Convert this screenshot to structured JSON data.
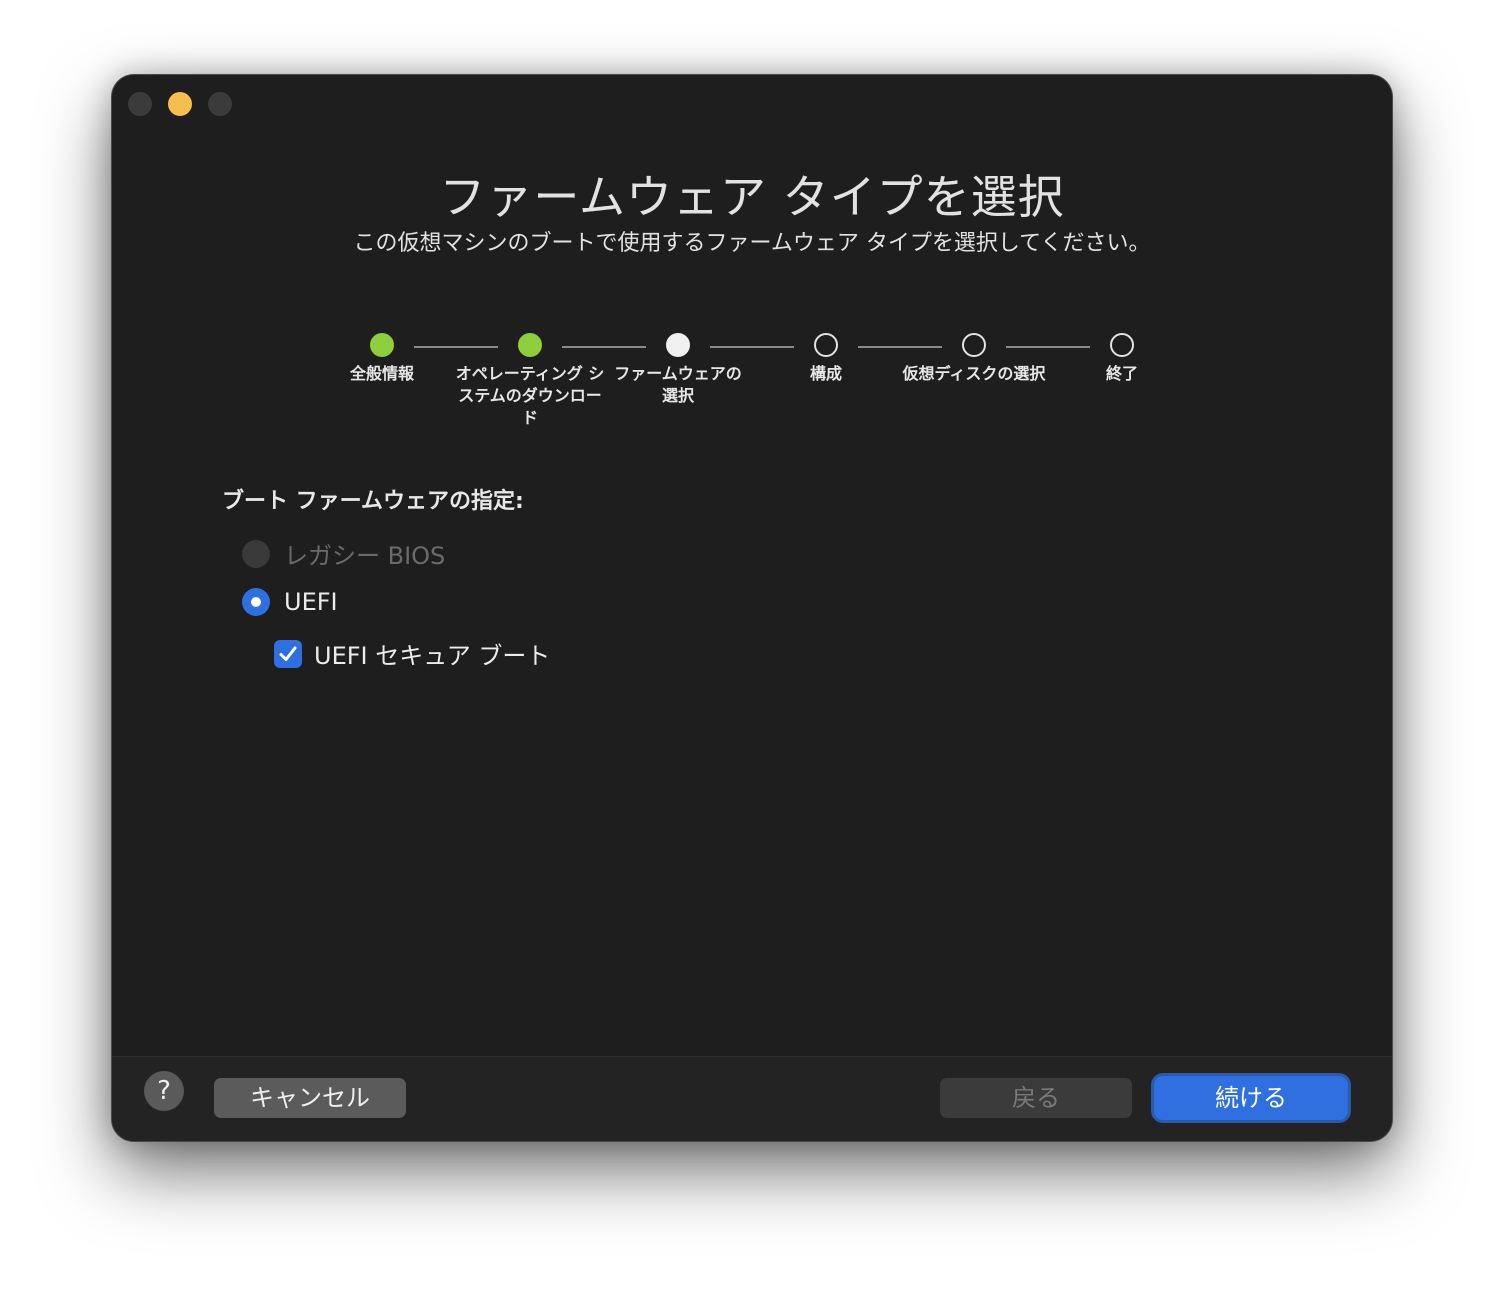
{
  "window": {
    "title": "ファームウェア タイプを選択",
    "subtitle": "この仮想マシンのブートで使用するファームウェア タイプを選択してください。"
  },
  "steps": [
    {
      "label": "全般情報",
      "state": "done"
    },
    {
      "label": "オペレーティング システムのダウンロード",
      "state": "done"
    },
    {
      "label": "ファームウェアの選択",
      "state": "current"
    },
    {
      "label": "構成",
      "state": "pending"
    },
    {
      "label": "仮想ディスクの選択",
      "state": "pending"
    },
    {
      "label": "終了",
      "state": "pending"
    }
  ],
  "form": {
    "section_label": "ブート ファームウェアの指定:",
    "options": [
      {
        "label": "レガシー BIOS",
        "selected": false,
        "enabled": false
      },
      {
        "label": "UEFI",
        "selected": true,
        "enabled": true
      }
    ],
    "secure_boot": {
      "label": "UEFI セキュア ブート",
      "checked": true
    }
  },
  "footer": {
    "help_label": "?",
    "cancel_label": "キャンセル",
    "back_label": "戻る",
    "continue_label": "続ける"
  },
  "colors": {
    "accent": "#2f6fe0",
    "step_done": "#8fce3c",
    "window_bg": "#1e1e1e"
  }
}
